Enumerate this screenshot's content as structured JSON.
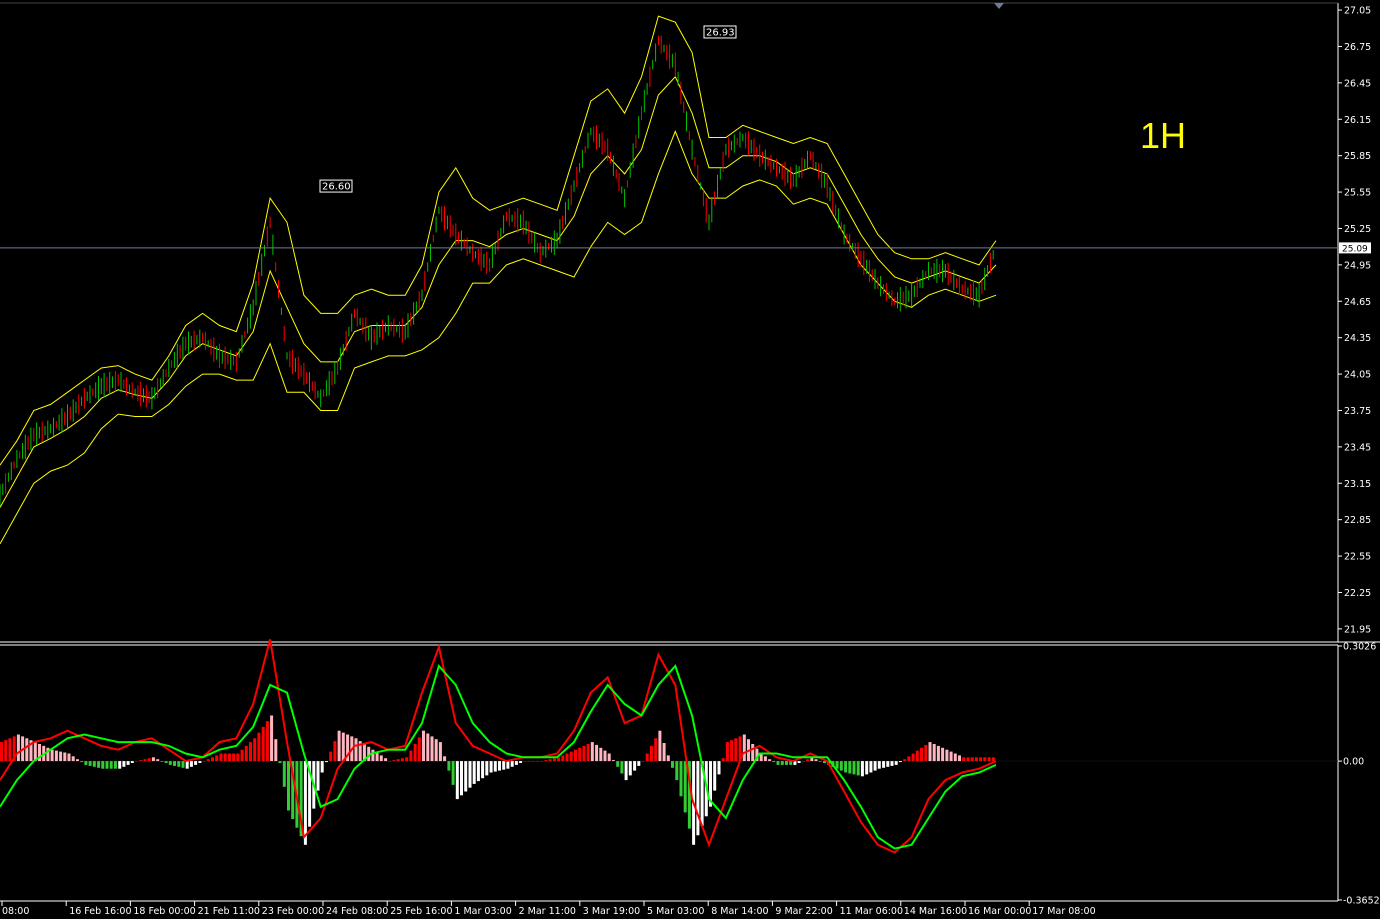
{
  "timeframe_label": "1H",
  "colors": {
    "background": "#000000",
    "axis": "#ffffff",
    "bull_candle": "#00c000",
    "bear_candle": "#ff0000",
    "bollinger": "#ffff00",
    "price_line": "#6e7b96",
    "macd_main": "#ff0000",
    "macd_signal": "#00ff00",
    "hist_up_rising": "#ff0000",
    "hist_up_falling": "#ffb6c1",
    "hist_down_falling": "#32cd32",
    "hist_down_rising": "#ffffff"
  },
  "price_axis": {
    "ticks": [
      "27.05",
      "26.75",
      "26.45",
      "26.15",
      "25.85",
      "25.55",
      "25.25",
      "24.95",
      "24.65",
      "24.35",
      "24.05",
      "23.75",
      "23.45",
      "23.15",
      "22.85",
      "22.55",
      "22.25",
      "21.95"
    ],
    "current_price": "25.09"
  },
  "indicator_axis": {
    "ticks": [
      "0.3026",
      "0.00",
      "-0.3652"
    ]
  },
  "time_axis": {
    "labels": [
      "08:00",
      "16 Feb 16:00",
      "18 Feb 00:00",
      "21 Feb 11:00",
      "23 Feb 00:00",
      "24 Feb 08:00",
      "25 Feb 16:00",
      "1 Mar 03:00",
      "2 Mar 11:00",
      "3 Mar 19:00",
      "5 Mar 03:00",
      "8 Mar 14:00",
      "9 Mar 22:00",
      "11 Mar 06:00",
      "14 Mar 16:00",
      "16 Mar 00:00",
      "17 Mar 08:00"
    ]
  },
  "annotations": [
    {
      "text": "26.60",
      "price": 25.55
    },
    {
      "text": "26.93",
      "price": 26.82
    }
  ],
  "chart_data": {
    "type": "line",
    "title": "",
    "price_panel": {
      "series": [
        {
          "values": [
            23.05,
            23.35,
            23.55,
            23.6,
            23.7,
            23.85,
            23.95,
            24.0,
            23.9,
            23.85,
            24.1,
            24.3,
            24.35,
            24.2,
            24.15,
            24.6,
            25.3,
            24.2,
            24.05,
            23.85,
            24.1,
            24.55,
            24.35,
            24.45,
            24.4,
            24.7,
            25.4,
            25.2,
            25.05,
            24.95,
            25.35,
            25.3,
            25.05,
            25.15,
            25.6,
            26.05,
            25.9,
            25.5,
            26.2,
            26.8,
            26.6,
            25.9,
            25.3,
            25.9,
            26.0,
            25.85,
            25.75,
            25.65,
            25.85,
            25.6,
            25.2,
            25.0,
            24.8,
            24.65,
            24.7,
            24.9,
            24.9,
            24.75,
            24.7,
            25.1
          ]
        },
        {
          "values": [
            22.95,
            23.2,
            23.45,
            23.52,
            23.6,
            23.7,
            23.85,
            23.92,
            23.88,
            23.85,
            24.0,
            24.2,
            24.3,
            24.25,
            24.2,
            24.4,
            24.9,
            24.6,
            24.3,
            24.15,
            24.15,
            24.4,
            24.45,
            24.45,
            24.45,
            24.6,
            24.95,
            25.15,
            25.15,
            25.1,
            25.2,
            25.25,
            25.2,
            25.15,
            25.35,
            25.7,
            25.85,
            25.7,
            25.9,
            26.35,
            26.5,
            26.2,
            25.75,
            25.75,
            25.85,
            25.85,
            25.8,
            25.7,
            25.75,
            25.7,
            25.45,
            25.2,
            25.0,
            24.85,
            24.8,
            24.85,
            24.9,
            24.85,
            24.8,
            24.95
          ]
        },
        {
          "values": [
            23.3,
            23.5,
            23.75,
            23.8,
            23.9,
            24.0,
            24.1,
            24.12,
            24.05,
            24.0,
            24.2,
            24.45,
            24.55,
            24.45,
            24.4,
            24.8,
            25.5,
            25.3,
            24.7,
            24.55,
            24.55,
            24.7,
            24.75,
            24.7,
            24.7,
            24.95,
            25.55,
            25.75,
            25.5,
            25.4,
            25.45,
            25.5,
            25.45,
            25.4,
            25.85,
            26.3,
            26.4,
            26.2,
            26.5,
            27.0,
            26.95,
            26.7,
            26.0,
            26.0,
            26.1,
            26.05,
            26.0,
            25.95,
            26.0,
            25.95,
            25.7,
            25.45,
            25.2,
            25.05,
            25.0,
            25.0,
            25.05,
            25.0,
            24.95,
            25.15
          ]
        },
        {
          "values": [
            22.65,
            22.9,
            23.15,
            23.25,
            23.3,
            23.4,
            23.6,
            23.72,
            23.7,
            23.7,
            23.8,
            23.95,
            24.05,
            24.05,
            24.0,
            24.0,
            24.3,
            23.9,
            23.9,
            23.75,
            23.75,
            24.1,
            24.15,
            24.2,
            24.2,
            24.25,
            24.35,
            24.55,
            24.8,
            24.8,
            24.95,
            25.0,
            24.95,
            24.9,
            24.85,
            25.1,
            25.3,
            25.2,
            25.3,
            25.7,
            26.05,
            25.7,
            25.5,
            25.5,
            25.6,
            25.65,
            25.6,
            25.45,
            25.5,
            25.45,
            25.2,
            24.95,
            24.8,
            24.65,
            24.6,
            24.7,
            24.75,
            24.7,
            24.65,
            24.7
          ]
        }
      ]
    },
    "macd_panel": {
      "series": [
        {
          "values": [
            -0.05,
            0.02,
            0.05,
            0.06,
            0.08,
            0.06,
            0.04,
            0.03,
            0.05,
            0.06,
            0.03,
            0.0,
            0.01,
            0.05,
            0.06,
            0.15,
            0.32,
            0.05,
            -0.2,
            -0.15,
            -0.02,
            0.04,
            0.05,
            0.03,
            0.04,
            0.18,
            0.3,
            0.1,
            0.04,
            0.02,
            0.0,
            0.01,
            0.01,
            0.02,
            0.08,
            0.18,
            0.22,
            0.1,
            0.12,
            0.28,
            0.2,
            -0.1,
            -0.22,
            -0.1,
            0.02,
            0.04,
            0.01,
            0.0,
            0.02,
            0.0,
            -0.08,
            -0.16,
            -0.22,
            -0.24,
            -0.2,
            -0.1,
            -0.05,
            -0.03,
            -0.02,
            0.0
          ]
        },
        {
          "values": [
            -0.12,
            -0.05,
            0.0,
            0.03,
            0.06,
            0.07,
            0.06,
            0.05,
            0.05,
            0.05,
            0.04,
            0.02,
            0.01,
            0.03,
            0.04,
            0.09,
            0.2,
            0.18,
            0.02,
            -0.12,
            -0.1,
            -0.02,
            0.02,
            0.03,
            0.03,
            0.1,
            0.25,
            0.2,
            0.1,
            0.05,
            0.02,
            0.01,
            0.01,
            0.01,
            0.05,
            0.13,
            0.2,
            0.15,
            0.12,
            0.2,
            0.25,
            0.12,
            -0.1,
            -0.15,
            -0.05,
            0.02,
            0.02,
            0.01,
            0.01,
            0.01,
            -0.05,
            -0.12,
            -0.2,
            -0.23,
            -0.22,
            -0.15,
            -0.08,
            -0.04,
            -0.03,
            -0.01
          ]
        }
      ],
      "histogram": [
        0.05,
        0.07,
        0.05,
        0.03,
        0.02,
        -0.01,
        -0.02,
        -0.02,
        0.0,
        0.01,
        -0.01,
        -0.02,
        0.0,
        0.02,
        0.02,
        0.06,
        0.12,
        -0.13,
        -0.22,
        -0.03,
        0.08,
        0.06,
        0.03,
        0.0,
        0.01,
        0.08,
        0.05,
        -0.1,
        -0.06,
        -0.03,
        -0.02,
        0.0,
        0.0,
        0.01,
        0.03,
        0.05,
        0.02,
        -0.05,
        0.0,
        0.08,
        -0.05,
        -0.22,
        -0.12,
        0.05,
        0.07,
        0.02,
        -0.01,
        -0.01,
        0.01,
        -0.01,
        -0.03,
        -0.04,
        -0.02,
        -0.01,
        0.02,
        0.05,
        0.03,
        0.01,
        0.01,
        0.01
      ],
      "ylim": [
        -0.3652,
        0.3026
      ]
    },
    "ylim": [
      21.85,
      27.1
    ]
  }
}
